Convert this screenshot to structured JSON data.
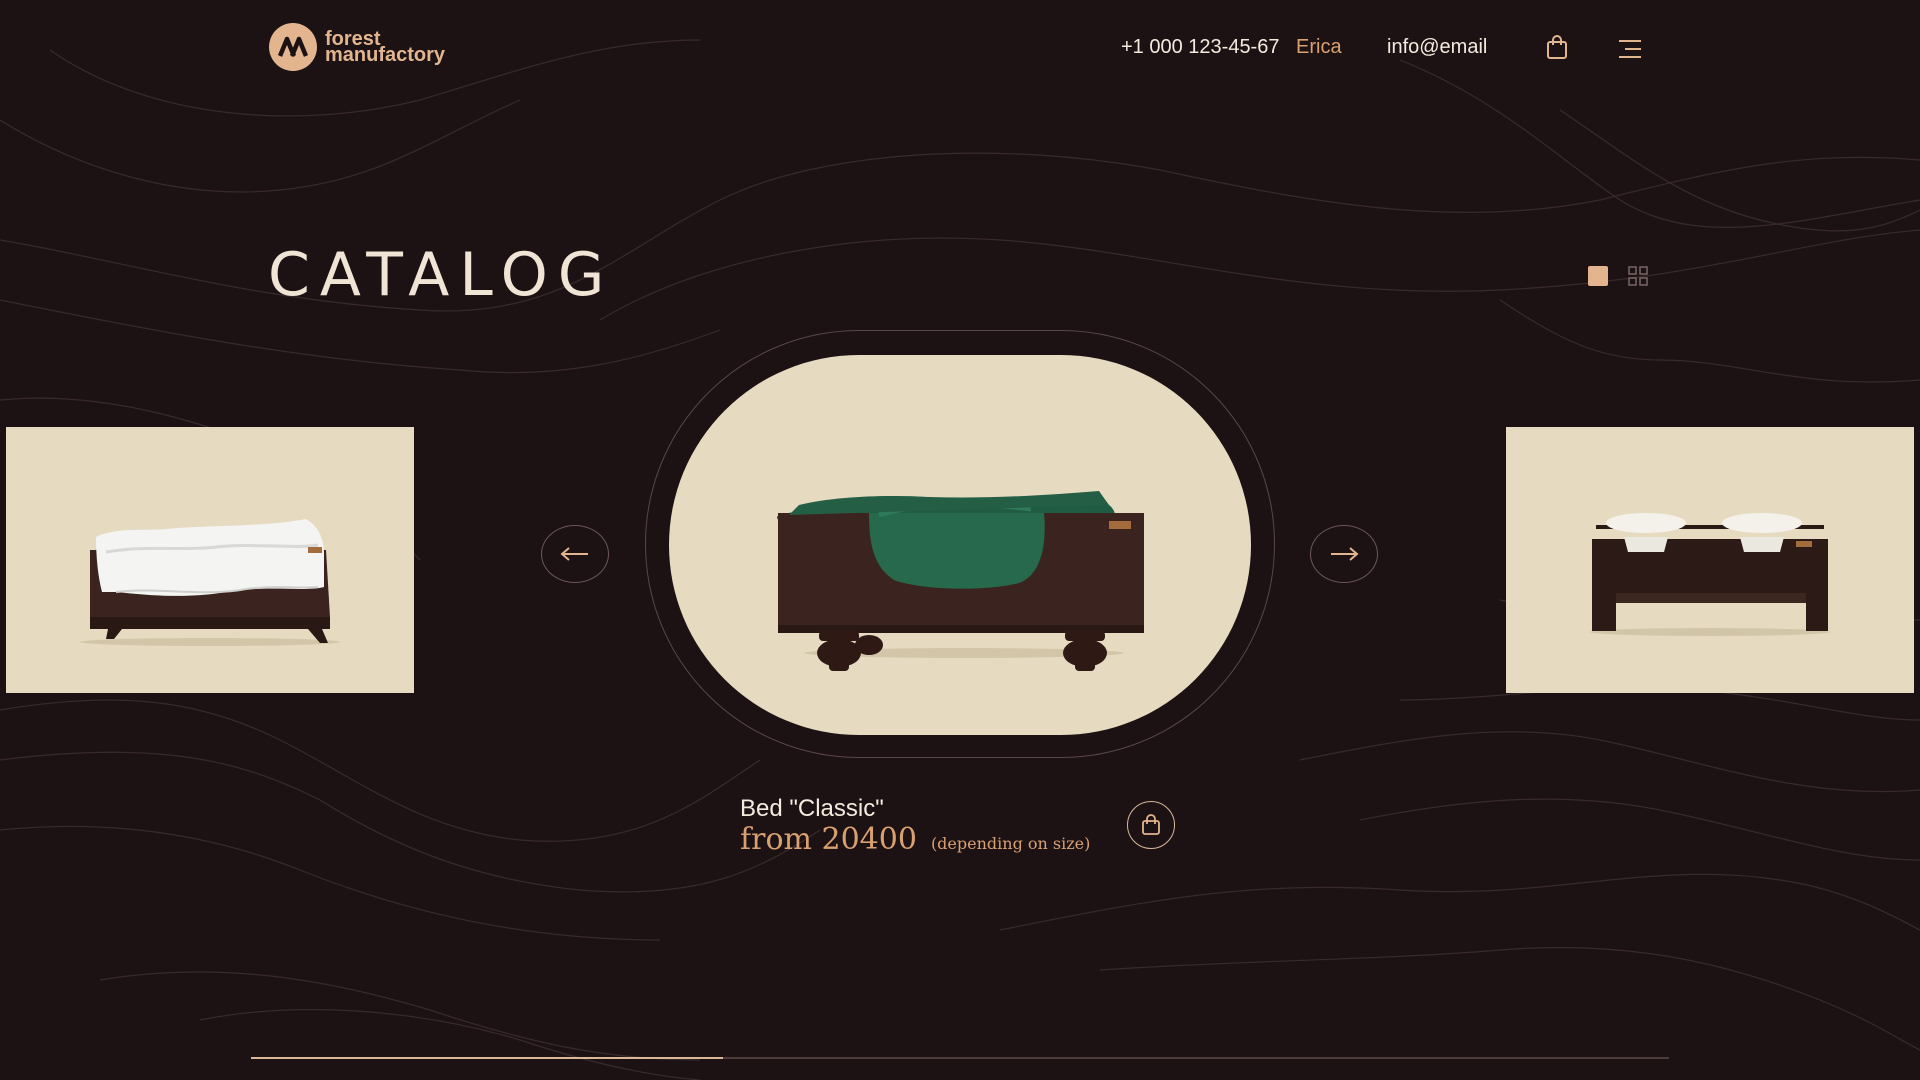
{
  "brand": {
    "line1": "forest",
    "line2": "manufactory",
    "color": "#e2b58f"
  },
  "header": {
    "phone": "+1 000 123-45-67",
    "contact_name": "Erica",
    "email": "info@email",
    "cart_icon": "shopping-bag-icon",
    "menu_icon": "hamburger-menu-icon"
  },
  "catalog": {
    "title": "CATALOG",
    "view_modes": [
      "single-view",
      "grid-view"
    ],
    "active_view": "single-view"
  },
  "carousel": {
    "prev_icon": "arrow-left-icon",
    "next_icon": "arrow-right-icon",
    "items": [
      {
        "image": "bed with white cushion"
      },
      {
        "image": "bed with green cushion"
      },
      {
        "image": "double bowl stand"
      }
    ],
    "progress": 0.333
  },
  "product": {
    "name": "Bed \"Classic\"",
    "price": "from 20400",
    "price_note": "(depending on size)",
    "cart_icon": "shopping-bag-icon"
  },
  "colors": {
    "background": "#1c1214",
    "accent": "#d9a070",
    "card": "#e6dbc0"
  }
}
